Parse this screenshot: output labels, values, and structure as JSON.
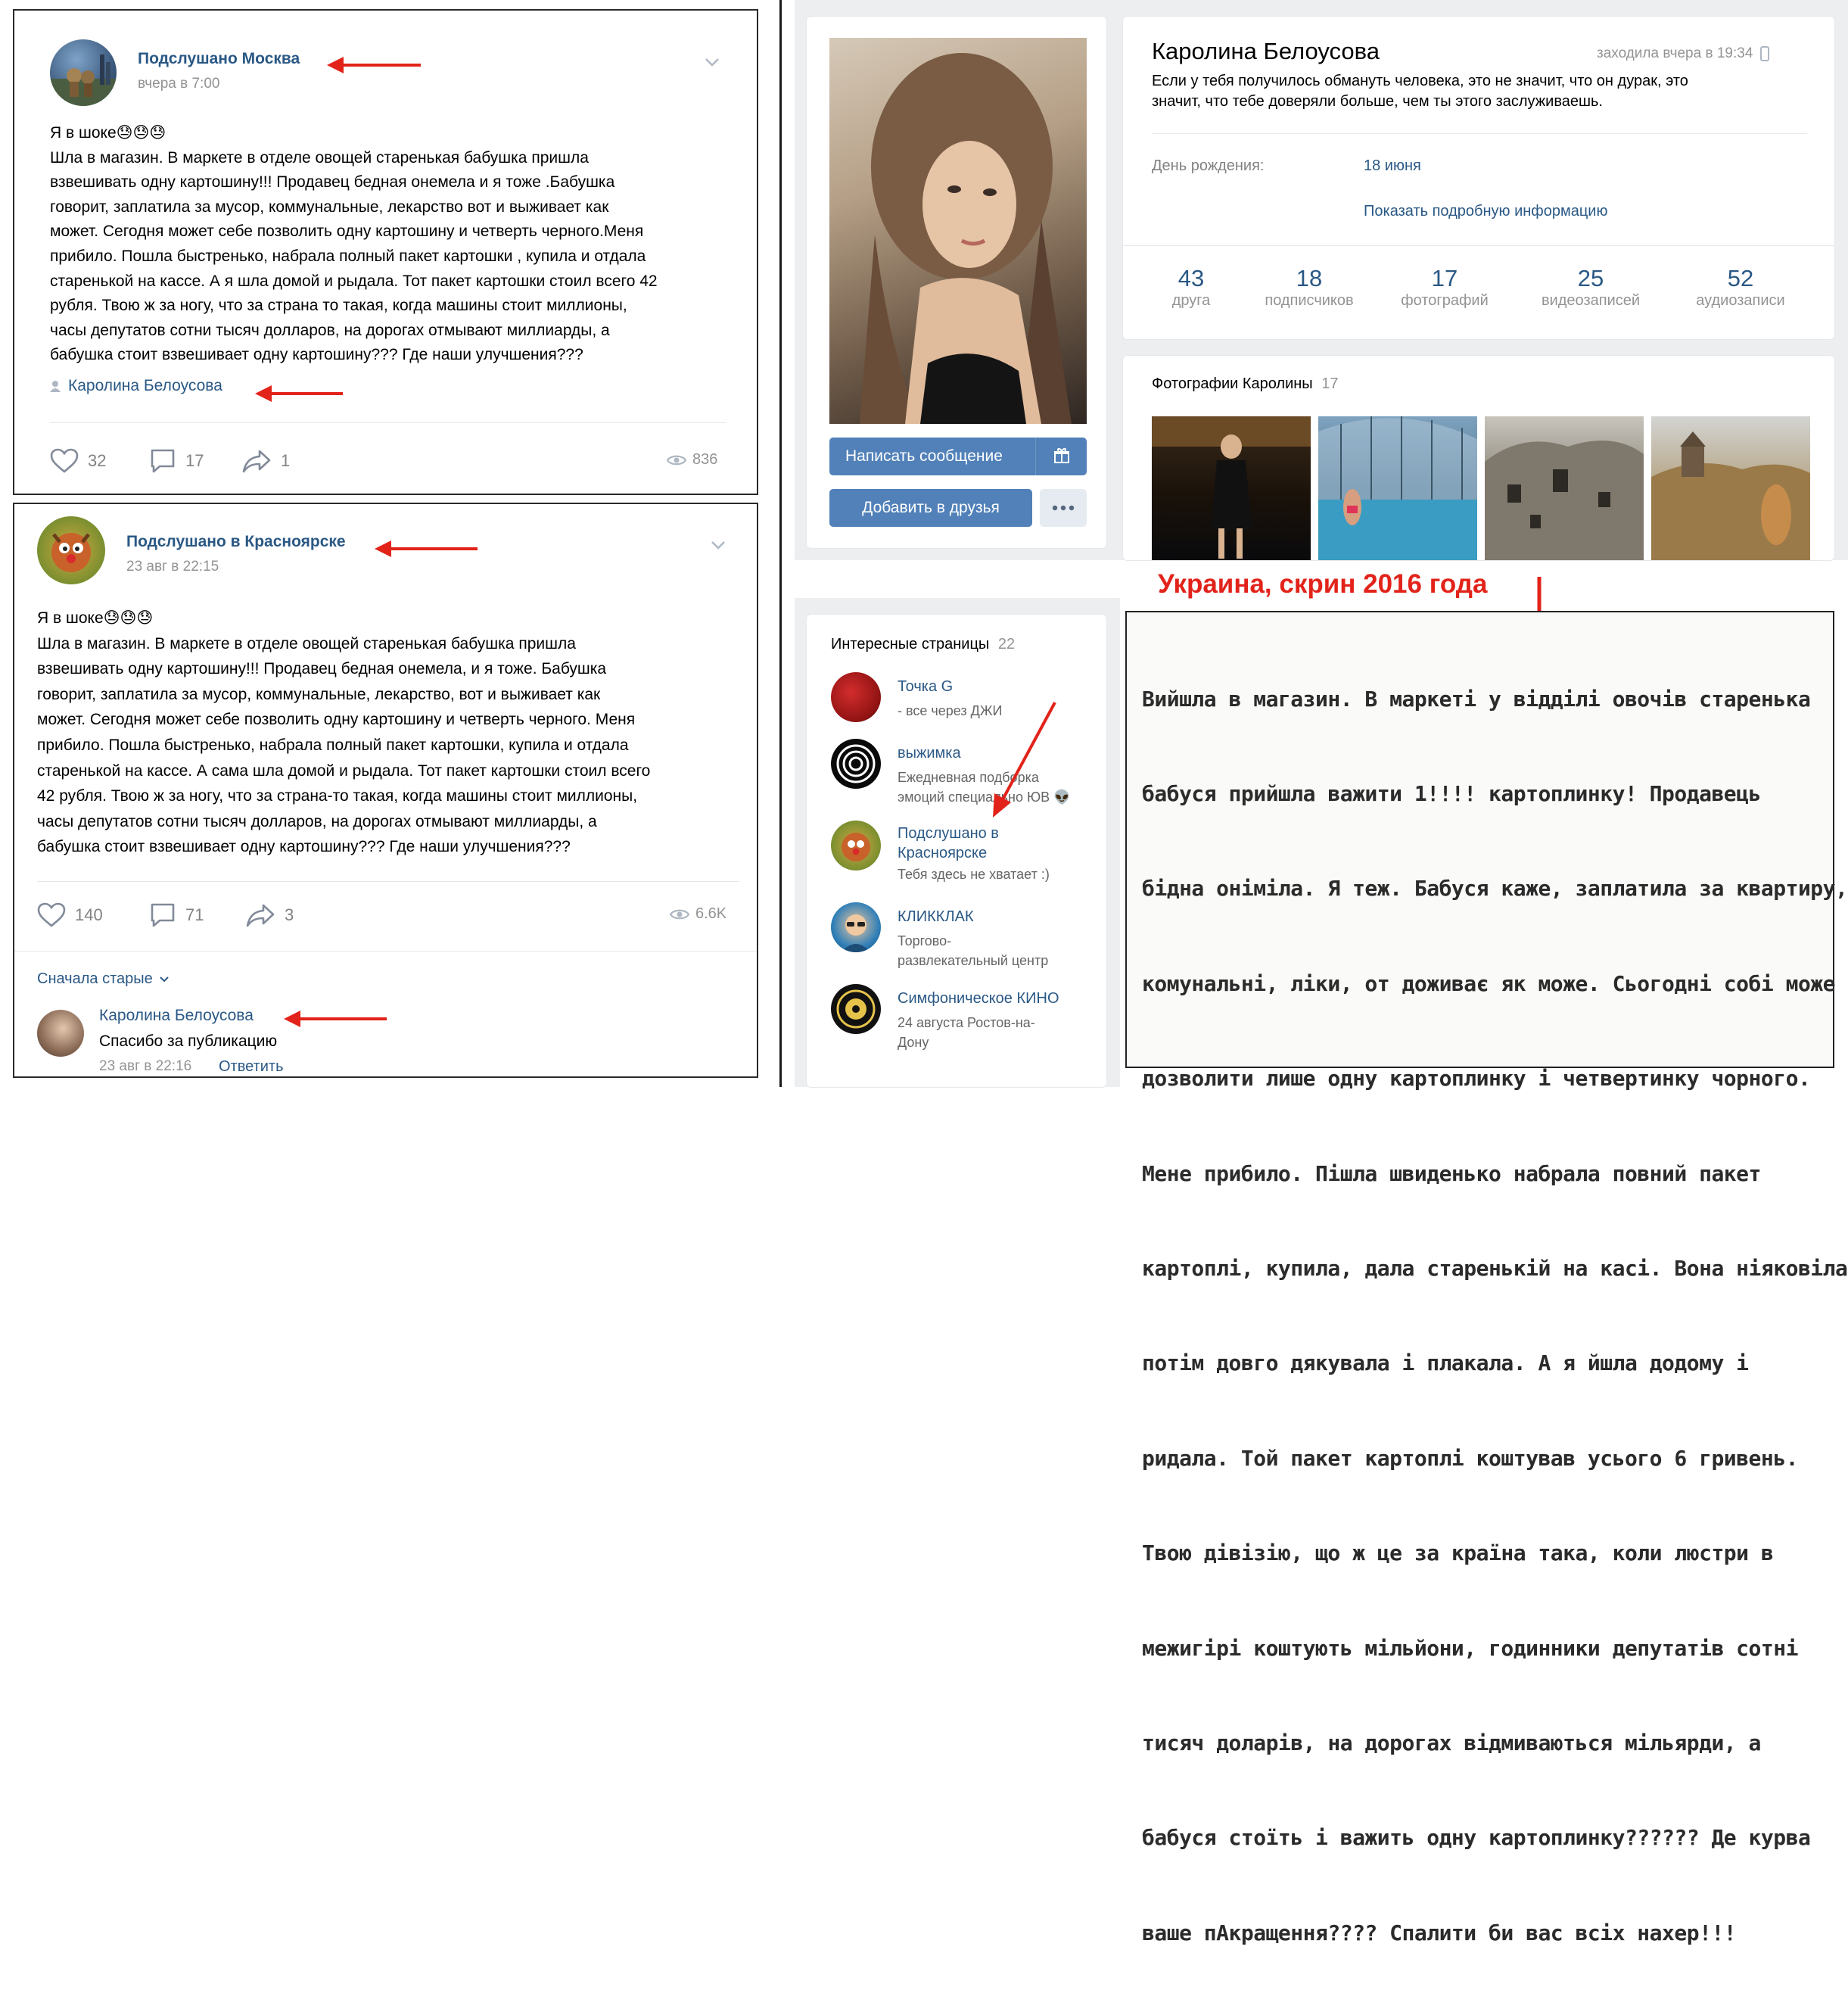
{
  "post1": {
    "community": "Подслушано Москва",
    "date": "вчера в 7:00",
    "lines": [
      "Я в шоке😓😓😓",
      "Шла в магазин. В маркете в отделе овощей старенькая бабушка пришла",
      "взвешивать одну картошину!!! Продавец бедная онемела и я тоже .Бабушка",
      "говорит, заплатила за мусор, коммунальные, лекарство вот и выживает как",
      "может. Сегодня может себе позволить одну картошину и четверть черного.Меня",
      "прибило. Пошла быстренько, набрала полный пакет картошки , купила и отдала",
      "старенькой на кассе. А я шла домой и рыдала. Тот пакет картошки стоил всего 42",
      "рубля. Твою ж за ногу, что за страна то такая, когда машины стоит миллионы,",
      "часы депутатов сотни тысяч долларов, на дорогах отмывают миллиарды, а",
      "бабушка стоит взвешивает одну картошину??? Где наши улучшения???"
    ],
    "author": "Каролина Белоусова",
    "likes": "32",
    "comments": "17",
    "shares": "1",
    "views": "836"
  },
  "post2": {
    "community": "Подслушано в Красноярске",
    "date": "23 авг в 22:15",
    "lines": [
      "Я в шоке😓😓😓",
      "Шла в магазин. В маркете в отделе овощей старенькая бабушка пришла",
      "взвешивать одну картошину!!! Продавец бедная онемела, и я тоже. Бабушка",
      "говорит, заплатила за мусор, коммунальные, лекарство, вот и выживает как",
      "может. Сегодня может себе позволить одну картошину и четверть черного. Меня",
      "прибило. Пошла быстренько, набрала полный пакет картошки, купила и отдала",
      "старенькой на кассе. А сама шла домой и рыдала. Тот пакет картошки стоил всего",
      "42 рубля. Твою ж за ногу, что за страна-то такая, когда машины стоит миллионы,",
      "часы депутатов сотни тысяч долларов, на дорогах отмывают миллиарды, а",
      "бабушка стоит взвешивает одну картошину??? Где наши улучшения???"
    ],
    "likes": "140",
    "comments": "71",
    "shares": "3",
    "views": "6.6K",
    "sort": "Сначала старые",
    "comment_author": "Каролина Белоусова",
    "comment_text": "Спасибо за публикацию",
    "comment_date": "23 авг в 22:16",
    "reply": "Ответить"
  },
  "profile": {
    "name": "Каролина Белоусова",
    "last_seen": "заходила вчера в 19:34",
    "status_line1": "Если у тебя получилось обмануть человека, это не значит, что он дурак, это",
    "status_line2": "значит, что тебе доверяли больше, чем ты этого заслуживаешь.",
    "birthday_label": "День рождения:",
    "birthday_value": "18 июня",
    "show_more": "Показать подробную информацию",
    "write_message": "Написать сообщение",
    "add_friend": "Добавить в друзья",
    "stats": [
      {
        "num": "43",
        "label": "друга"
      },
      {
        "num": "18",
        "label": "подписчиков"
      },
      {
        "num": "17",
        "label": "фотографий"
      },
      {
        "num": "25",
        "label": "видеозаписей"
      },
      {
        "num": "52",
        "label": "аудиозаписи"
      }
    ],
    "photos_title": "Фотографии Каролины",
    "photos_count": "17"
  },
  "interesting": {
    "title": "Интересные страницы",
    "count": "22",
    "items": [
      {
        "name": "Точка G",
        "desc1": "- все через ДЖИ",
        "desc2": ""
      },
      {
        "name": "выжимка",
        "desc1": "Ежедневная подборка",
        "desc2": "эмоций специально ЮВ 👽"
      },
      {
        "name": "Подслушано в",
        "name2": "Красноярске",
        "desc1": "Тебя здесь не хватает :)",
        "desc2": ""
      },
      {
        "name": "КЛИККЛАК",
        "desc1": "Торгово-",
        "desc2": "развлекательный центр"
      },
      {
        "name": "Симфоническое КИНО",
        "desc1": "24 августа Ростов-на-",
        "desc2": "Дону"
      }
    ]
  },
  "annotation": {
    "title": "Украина, скрин 2016 года",
    "scan_lines": [
      "Вийшла в магазин. В маркеті у відділі овочів старенька",
      "бабуся прийшла важити 1!!!! картоплинку! Продавець",
      "бідна оніміла. Я теж. Бабуся каже, заплатила за квартиру,",
      "комунальні, ліки, от доживає як може. Сьогодні собі може",
      "дозволити лише одну картоплинку і четвертинку чорного.",
      "Мене прибило. Пішла швиденько набрала повний пакет",
      "картоплі, купила, дала старенькій на касі. Вона ніяковіла,",
      "потім довго дякувала і плакала. А я йшла додому і",
      "ридала. Той пакет картоплі коштував усього 6 гривень.",
      "Твою дівізію, що ж це за країна така, коли люстри в",
      "межигірі коштують мільйони, годинники депутатів сотні",
      "тисяч доларів, на дорогах відмиваються мільярди, а",
      "бабуся стоїть і важить одну картоплинку?????? Де курва",
      "ваше пАкращення???? Спалити би вас всіх нахер!!!"
    ]
  },
  "colors": {
    "link": "#2a5885",
    "button": "#5181b8",
    "arrow_red": "#e2231a",
    "page_bg": "#edeef0"
  }
}
